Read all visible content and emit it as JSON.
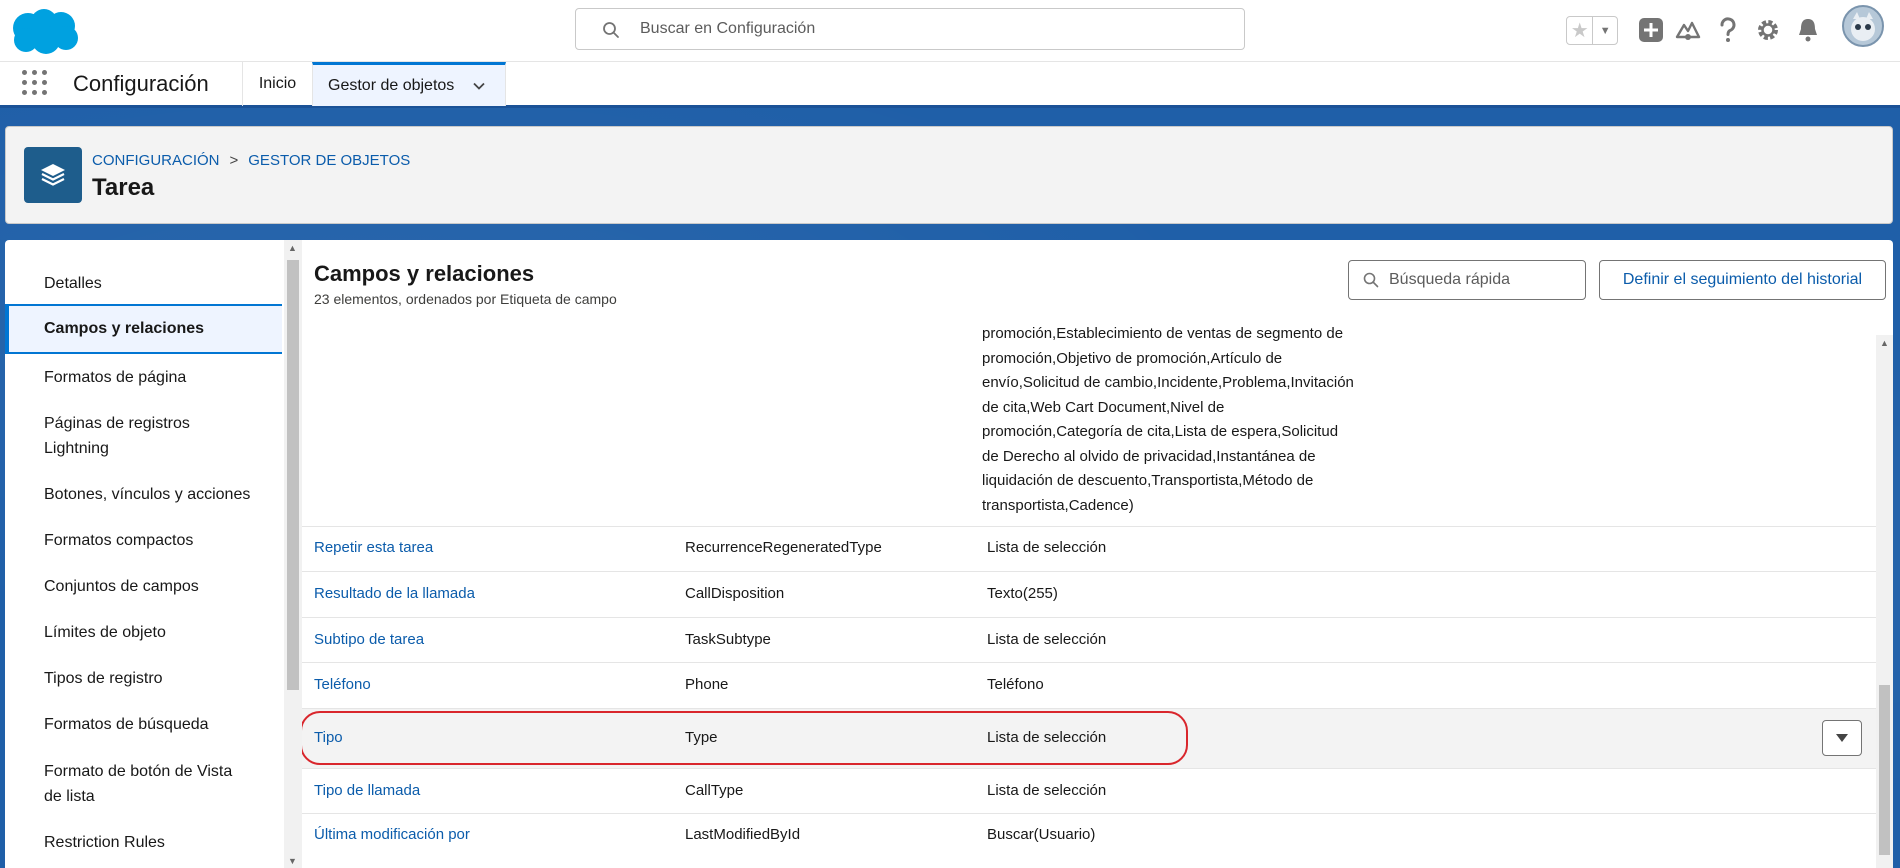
{
  "header": {
    "search_placeholder": "Buscar en Configuración",
    "icons": [
      "salesforce-cloud-logo",
      "search-icon",
      "star-icon",
      "chevron-down-icon",
      "plus-icon",
      "trailhead-icon",
      "help-icon",
      "gear-icon",
      "bell-icon",
      "avatar"
    ]
  },
  "context_bar": {
    "app_name": "Configuración",
    "tabs": [
      {
        "label": "Inicio"
      },
      {
        "label": "Gestor de objetos"
      }
    ]
  },
  "page_header": {
    "breadcrumb": [
      "CONFIGURACIÓN",
      "GESTOR DE OBJETOS"
    ],
    "breadcrumb_sep": ">",
    "title": "Tarea"
  },
  "sidebar": {
    "items": [
      {
        "label": "Detalles"
      },
      {
        "label": "Campos y relaciones"
      },
      {
        "label": "Formatos de página"
      },
      {
        "label": "Páginas de registros Lightning"
      },
      {
        "label": "Botones, vínculos y acciones"
      },
      {
        "label": "Formatos compactos"
      },
      {
        "label": "Conjuntos de campos"
      },
      {
        "label": "Límites de objeto"
      },
      {
        "label": "Tipos de registro"
      },
      {
        "label": "Formatos de búsqueda"
      },
      {
        "label": "Formato de botón de Vista de lista"
      },
      {
        "label": "Restriction Rules"
      }
    ],
    "active_index": 1
  },
  "section": {
    "title": "Campos y relaciones",
    "subtitle": "23 elementos, ordenados por Etiqueta de campo",
    "quick_find_placeholder": "Búsqueda rápida",
    "history_button": "Definir el seguimiento del historial"
  },
  "table": {
    "wrapped_text_lines": [
      "promoción,Establecimiento de ventas de segmento de",
      "promoción,Objetivo de promoción,Artículo de",
      "envío,Solicitud de cambio,Incidente,Problema,Invitación",
      "de cita,Web Cart Document,Nivel de",
      "promoción,Categoría de cita,Lista de espera,Solicitud",
      "de Derecho al olvido de privacidad,Instantánea de",
      "liquidación de descuento,Transportista,Método de",
      "transportista,Cadence)"
    ],
    "rows": [
      {
        "label": "Repetir esta tarea",
        "api": "RecurrenceRegeneratedType",
        "type": "Lista de selección"
      },
      {
        "label": "Resultado de la llamada",
        "api": "CallDisposition",
        "type": "Texto(255)"
      },
      {
        "label": "Subtipo de tarea",
        "api": "TaskSubtype",
        "type": "Lista de selección"
      },
      {
        "label": "Teléfono",
        "api": "Phone",
        "type": "Teléfono"
      },
      {
        "label": "Tipo",
        "api": "Type",
        "type": "Lista de selección"
      },
      {
        "label": "Tipo de llamada",
        "api": "CallType",
        "type": "Lista de selección"
      },
      {
        "label": "Última modificación por",
        "api": "LastModifiedById",
        "type": "Buscar(Usuario)"
      }
    ],
    "highlighted_row_index": 4
  },
  "colors": {
    "brand_blue": "#0176d3",
    "link_blue": "#0b5cab",
    "backdrop_blue": "#1f5fa8",
    "highlight_red": "#d9262c"
  }
}
